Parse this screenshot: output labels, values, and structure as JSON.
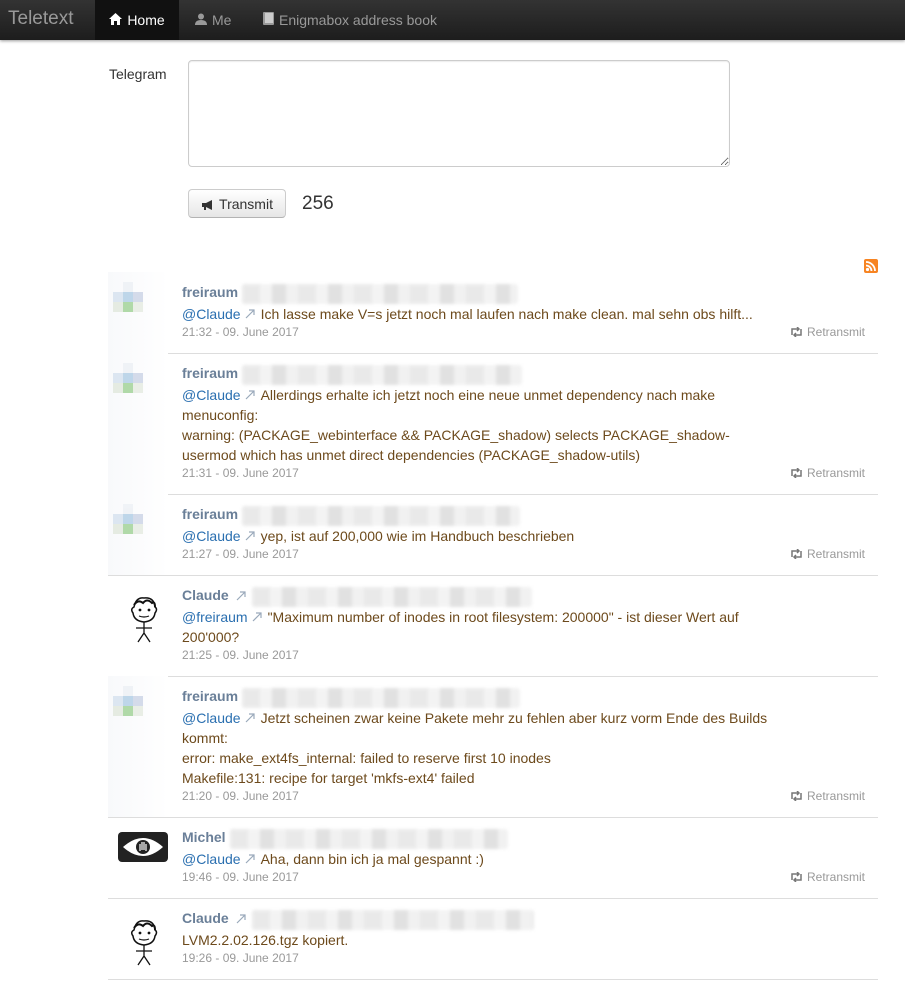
{
  "nav": {
    "brand": "Teletext",
    "home": "Home",
    "me": "Me",
    "book": "Enigmabox address book"
  },
  "form": {
    "label": "Telegram",
    "textarea_value": "",
    "button": "Transmit",
    "counter": "256"
  },
  "colors": {
    "author": "#6a7f98",
    "text": "#6d4a1c",
    "mention": "#2a6fb0",
    "rss": "#f78422"
  },
  "retransmit_label": "Retransmit",
  "items": [
    {
      "author": "freiraum",
      "mention": "@Claude",
      "text_lines": [
        "Ich lasse make V=s jetzt noch mal laufen nach make clean. mal sehn obs hilft..."
      ],
      "time": "21:32 - 09. June 2017",
      "retransmit": true,
      "avatar": "identicon"
    },
    {
      "author": "freiraum",
      "mention": "@Claude",
      "text_lines": [
        "Allerdings erhalte ich jetzt noch eine neue unmet dependency nach make",
        "menuconfig:",
        "warning: (PACKAGE_webinterface && PACKAGE_shadow) selects PACKAGE_shadow-",
        "usermod which has unmet direct dependencies (PACKAGE_shadow-utils)"
      ],
      "time": "21:31 - 09. June 2017",
      "retransmit": true,
      "avatar": "identicon"
    },
    {
      "author": "freiraum",
      "mention": "@Claude",
      "text_lines": [
        "yep, ist auf 200,000 wie im Handbuch beschrieben"
      ],
      "time": "21:27 - 09. June 2017",
      "retransmit": true,
      "avatar": "identicon"
    },
    {
      "author": "Claude",
      "mention": "@freiraum",
      "text_lines": [
        "\"Maximum number of inodes in root filesystem: 200000\" - ist dieser Wert auf",
        "200'000?"
      ],
      "time": "21:25 - 09. June 2017",
      "retransmit": false,
      "avatar": "doodle"
    },
    {
      "author": "freiraum",
      "mention": "@Claude",
      "text_lines": [
        "Jetzt scheinen zwar keine Pakete mehr zu fehlen aber kurz vorm Ende des Builds",
        "kommt:",
        "error: make_ext4fs_internal: failed to reserve first 10 inodes",
        "Makefile:131: recipe for target 'mkfs-ext4' failed"
      ],
      "time": "21:20 - 09. June 2017",
      "retransmit": true,
      "avatar": "identicon"
    },
    {
      "author": "Michel",
      "mention": "@Claude",
      "text_lines": [
        "Aha, dann bin ich ja mal gespannt :)"
      ],
      "time": "19:46 - 09. June 2017",
      "retransmit": true,
      "avatar": "eye"
    },
    {
      "author": "Claude",
      "mention": "",
      "text_lines": [
        "LVM2.2.02.126.tgz kopiert."
      ],
      "time": "19:26 - 09. June 2017",
      "retransmit": false,
      "avatar": "doodle"
    }
  ]
}
